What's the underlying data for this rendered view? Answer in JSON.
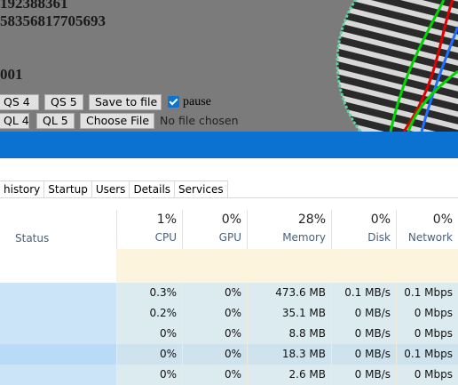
{
  "emulator": {
    "stats": [
      "192388361",
      "58356817705693",
      "001"
    ],
    "buttons": {
      "qs4": "QS 4",
      "qs5": "QS 5",
      "save_to_file": "Save to file",
      "ql4": "QL 4",
      "ql5": "QL 5",
      "choose_file": "Choose File"
    },
    "pause_label": "pause",
    "pause_checked": true,
    "file_status": "No file chosen"
  },
  "taskmanager": {
    "tabs": [
      "history",
      "Startup",
      "Users",
      "Details",
      "Services"
    ],
    "columns": {
      "status": "Status",
      "cpu": {
        "pct": "1%",
        "name": "CPU"
      },
      "gpu": {
        "pct": "0%",
        "name": "GPU"
      },
      "memory": {
        "pct": "28%",
        "name": "Memory"
      },
      "disk": {
        "pct": "0%",
        "name": "Disk"
      },
      "network": {
        "pct": "0%",
        "name": "Network"
      }
    },
    "rows": [
      {
        "cpu": "0.3%",
        "gpu": "0%",
        "memory": "473.6 MB",
        "disk": "0.1 MB/s",
        "network": "0.1 Mbps"
      },
      {
        "cpu": "0.2%",
        "gpu": "0%",
        "memory": "35.1 MB",
        "disk": "0 MB/s",
        "network": "0 Mbps"
      },
      {
        "cpu": "0%",
        "gpu": "0%",
        "memory": "8.8 MB",
        "disk": "0 MB/s",
        "network": "0 Mbps"
      },
      {
        "cpu": "0%",
        "gpu": "0%",
        "memory": "18.3 MB",
        "disk": "0 MB/s",
        "network": "0.1 Mbps"
      },
      {
        "cpu": "0%",
        "gpu": "0%",
        "memory": "2.6 MB",
        "disk": "0 MB/s",
        "network": "0 Mbps"
      }
    ],
    "colors": {
      "titlebar": "#0c72d1",
      "heat_light": "#fdf4dd",
      "heat_row": "#dcebf0",
      "selected_row": "#cce4f7"
    }
  }
}
